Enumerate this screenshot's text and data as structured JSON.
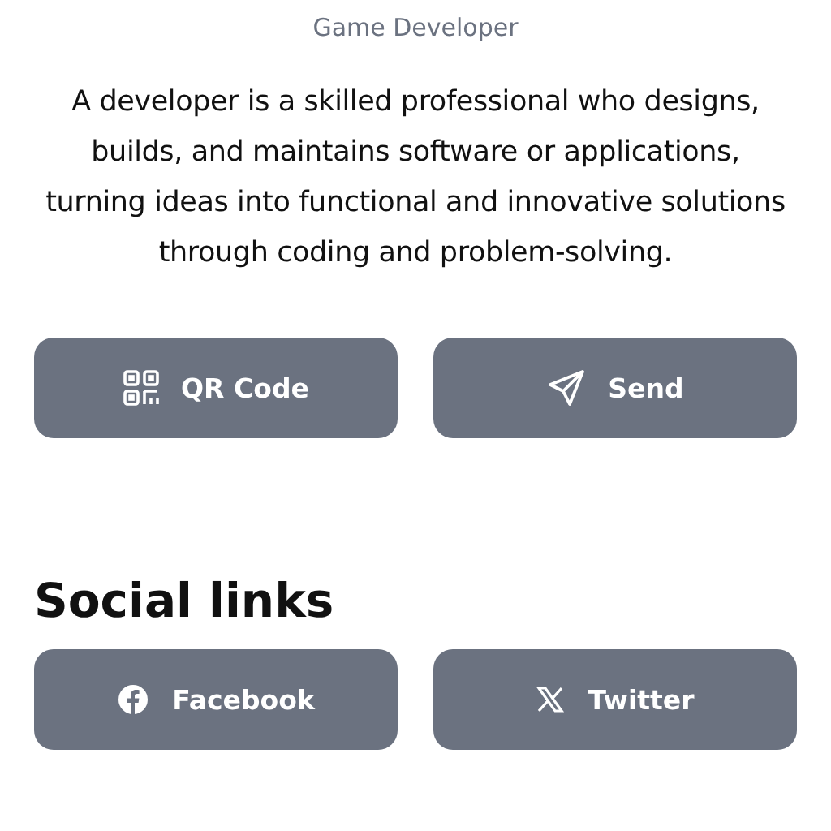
{
  "role": "Game Developer",
  "bio": "A developer is a skilled professional who designs, builds, and maintains software or applications, turning ideas into functional and innovative solutions through coding and problem-solving.",
  "actions": [
    {
      "label": "QR Code",
      "kind": "qr"
    },
    {
      "label": "Send",
      "kind": "send"
    }
  ],
  "social": {
    "heading": "Social links",
    "links": [
      {
        "label": "Facebook",
        "kind": "facebook"
      },
      {
        "label": "Twitter",
        "kind": "x"
      }
    ]
  }
}
